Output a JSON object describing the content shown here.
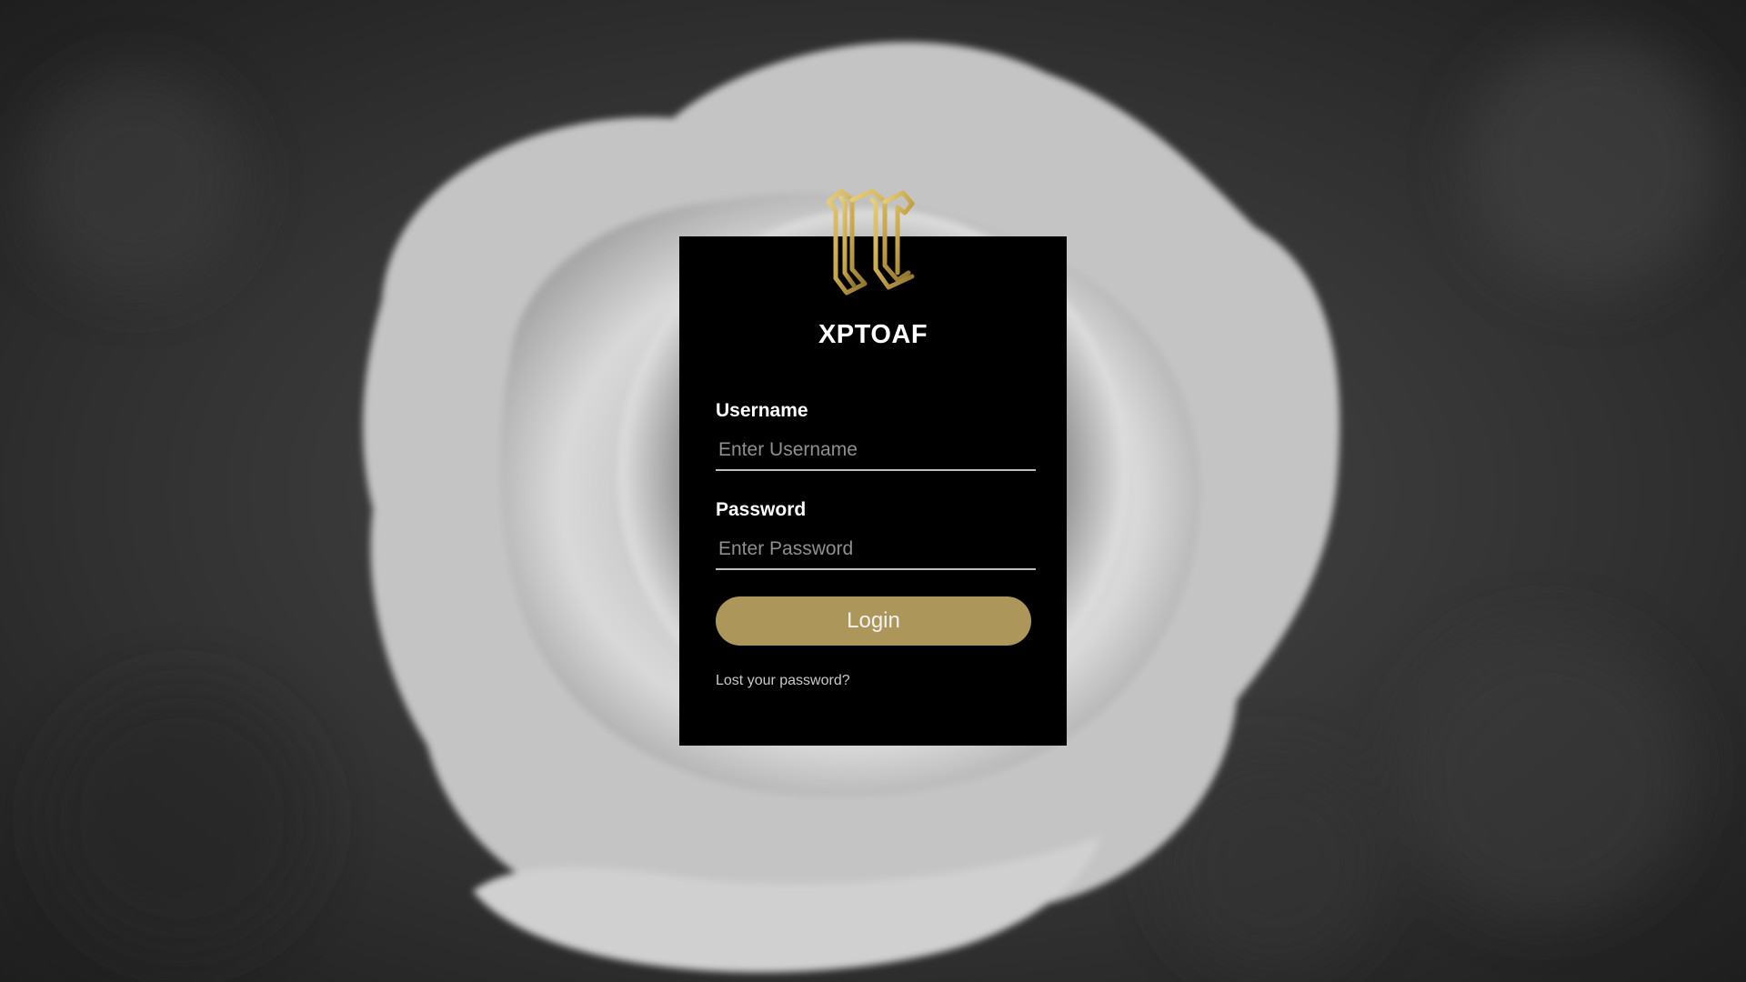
{
  "brand": {
    "name": "XPTOAF",
    "logo_icon": "gothic-letter-logo-icon",
    "logo_color": "#c9a74a"
  },
  "login_form": {
    "username_label": "Username",
    "username_placeholder": "Enter Username",
    "username_value": "",
    "password_label": "Password",
    "password_placeholder": "Enter Password",
    "password_value": "",
    "submit_label": "Login",
    "lost_password_text": "Lost your password?"
  },
  "theme": {
    "card_background": "#000000",
    "accent": "#ad9659",
    "background_image": "grayscale-rose-photo"
  }
}
